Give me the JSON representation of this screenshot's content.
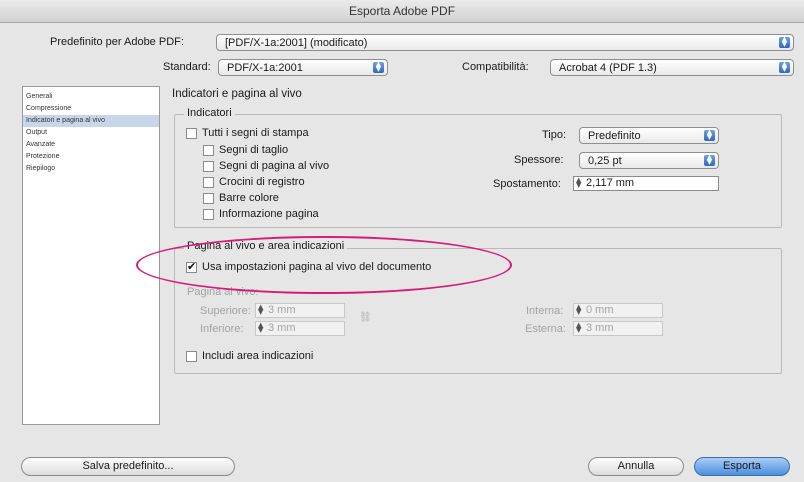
{
  "window": {
    "title": "Esporta Adobe PDF"
  },
  "header": {
    "preset_label": "Predefinito per Adobe PDF:",
    "preset_value": "[PDF/X-1a:2001] (modificato)",
    "standard_label": "Standard:",
    "standard_value": "PDF/X-1a:2001",
    "compat_label": "Compatibilità:",
    "compat_value": "Acrobat 4 (PDF 1.3)"
  },
  "sidebar": {
    "items": [
      {
        "label": "Generali"
      },
      {
        "label": "Compressione"
      },
      {
        "label": "Indicatori e pagina al vivo"
      },
      {
        "label": "Output"
      },
      {
        "label": "Avanzate"
      },
      {
        "label": "Protezione"
      },
      {
        "label": "Riepilogo"
      }
    ],
    "selected_index": 2
  },
  "section_title": "Indicatori e pagina al vivo",
  "marks": {
    "group_title": "Indicatori",
    "all_marks": "Tutti i segni di stampa",
    "crop": "Segni di taglio",
    "bleed": "Segni di pagina al vivo",
    "registration": "Crocini di registro",
    "color_bars": "Barre colore",
    "page_info": "Informazione pagina",
    "type_label": "Tipo:",
    "type_value": "Predefinito",
    "weight_label": "Spessore:",
    "weight_value": "0,25 pt",
    "offset_label": "Spostamento:",
    "offset_value": "2,117 mm"
  },
  "bleed": {
    "group_title": "Pagina al vivo e area indicazioni",
    "use_doc": "Usa impostazioni pagina al vivo del documento",
    "sub_label": "Pagina al vivo:",
    "top_label": "Superiore:",
    "top_value": "3 mm",
    "bottom_label": "Inferiore:",
    "bottom_value": "3 mm",
    "inside_label": "Interna:",
    "inside_value": "0 mm",
    "outside_label": "Esterna:",
    "outside_value": "3 mm",
    "slug": "Includi area indicazioni"
  },
  "footer": {
    "save_preset": "Salva predefinito...",
    "cancel": "Annulla",
    "export": "Esporta"
  },
  "colors": {
    "highlight_ellipse": "#d81b7a",
    "default_button": "#4b8fe0",
    "sidebar_selection": "#c7d6ea"
  },
  "icons": {
    "popup_arrows": "up-down-arrows",
    "stepper": "stepper-arrows",
    "checkmark": "check",
    "link": "chain-link"
  }
}
